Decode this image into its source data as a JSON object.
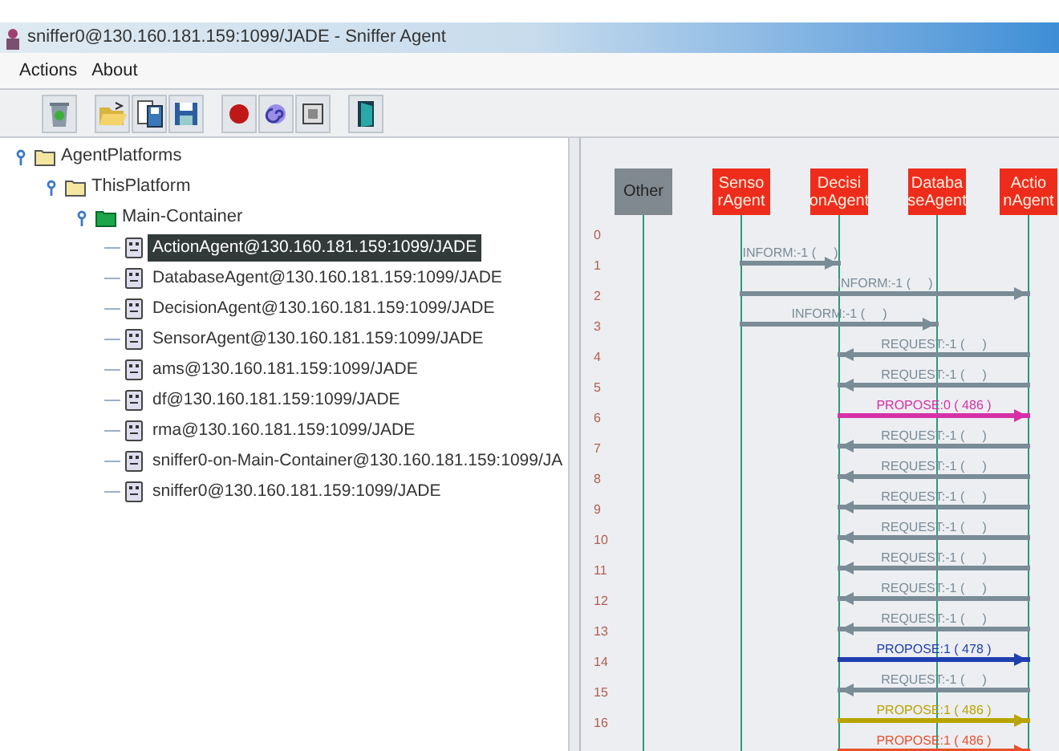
{
  "window": {
    "title": "sniffer0@130.160.181.159:1099/JADE - Sniffer Agent"
  },
  "menu": [
    "Actions",
    "About"
  ],
  "toolbar": [
    {
      "kind": "recycle"
    },
    {
      "kind": "open"
    },
    {
      "kind": "saveas"
    },
    {
      "kind": "save"
    },
    {
      "kind": "record"
    },
    {
      "kind": "swirl"
    },
    {
      "kind": "box"
    },
    {
      "kind": "door"
    }
  ],
  "tree": {
    "label": "AgentPlatforms",
    "expanded": true,
    "children": [
      {
        "label": "ThisPlatform",
        "expanded": true,
        "children": [
          {
            "label": "Main-Container",
            "expanded": true,
            "kind": "container",
            "children": [
              {
                "label": "ActionAgent@130.160.181.159:1099/JADE",
                "selected": true
              },
              {
                "label": "DatabaseAgent@130.160.181.159:1099/JADE",
                "selected": false
              },
              {
                "label": "DecisionAgent@130.160.181.159:1099/JADE",
                "selected": false
              },
              {
                "label": "SensorAgent@130.160.181.159:1099/JADE",
                "selected": false
              },
              {
                "label": "ams@130.160.181.159:1099/JADE",
                "selected": false
              },
              {
                "label": "df@130.160.181.159:1099/JADE",
                "selected": false
              },
              {
                "label": "rma@130.160.181.159:1099/JADE",
                "selected": false
              },
              {
                "label": "sniffer0-on-Main-Container@130.160.181.159:1099/JA",
                "selected": false
              },
              {
                "label": "sniffer0@130.160.181.159:1099/JADE",
                "selected": false
              }
            ]
          }
        ]
      }
    ]
  },
  "sniffer": {
    "agents": [
      {
        "lines": [
          "Other"
        ],
        "kind": "other"
      },
      {
        "lines": [
          "Senso",
          "rAgent"
        ],
        "kind": "agent"
      },
      {
        "lines": [
          "Decisi",
          "onAgent"
        ],
        "kind": "agent"
      },
      {
        "lines": [
          "Databa",
          "seAgent"
        ],
        "kind": "agent"
      },
      {
        "lines": [
          "Actio",
          "nAgent"
        ],
        "kind": "agent"
      }
    ],
    "row_numbers": [
      "0",
      "1",
      "2",
      "3",
      "4",
      "5",
      "6",
      "7",
      "8",
      "9",
      "10",
      "11",
      "12",
      "13",
      "14",
      "15",
      "16"
    ],
    "messages": [
      {
        "kind": "sensor_to_decision",
        "label": "INFORM:-1 (     )",
        "color": "#7a8c96"
      },
      {
        "kind": "sensor_to_action",
        "label": "INFORM:-1 (     )",
        "color": "#7a8c96"
      },
      {
        "kind": "sensor_to_database",
        "label": "INFORM:-1 (     )",
        "color": "#7a8c96"
      },
      {
        "kind": "action_to_decision",
        "label": "REQUEST:-1 (     )",
        "color": "#7a8c96"
      },
      {
        "kind": "action_to_decision",
        "label": "REQUEST:-1 (     )",
        "color": "#7a8c96"
      },
      {
        "kind": "decision_to_action",
        "label": "PROPOSE:0 ( 486 )",
        "color": "#d630a8"
      },
      {
        "kind": "action_to_decision",
        "label": "REQUEST:-1 (     )",
        "color": "#7a8c96"
      },
      {
        "kind": "action_to_decision",
        "label": "REQUEST:-1 (     )",
        "color": "#7a8c96"
      },
      {
        "kind": "action_to_decision",
        "label": "REQUEST:-1 (     )",
        "color": "#7a8c96"
      },
      {
        "kind": "action_to_decision",
        "label": "REQUEST:-1 (     )",
        "color": "#7a8c96"
      },
      {
        "kind": "action_to_decision",
        "label": "REQUEST:-1 (     )",
        "color": "#7a8c96"
      },
      {
        "kind": "action_to_decision",
        "label": "REQUEST:-1 (     )",
        "color": "#7a8c96"
      },
      {
        "kind": "action_to_decision",
        "label": "REQUEST:-1 (     )",
        "color": "#7a8c96"
      },
      {
        "kind": "decision_to_action",
        "label": "PROPOSE:1 ( 478 )",
        "color": "#1f3fb0"
      },
      {
        "kind": "action_to_decision",
        "label": "REQUEST:-1 (     )",
        "color": "#7a8c96"
      },
      {
        "kind": "decision_to_action",
        "label": "PROPOSE:1 ( 486 )",
        "color": "#b8a400"
      },
      {
        "kind": "decision_to_action",
        "label": "PROPOSE:1 ( 486 )",
        "color": "#e8502a"
      }
    ]
  }
}
